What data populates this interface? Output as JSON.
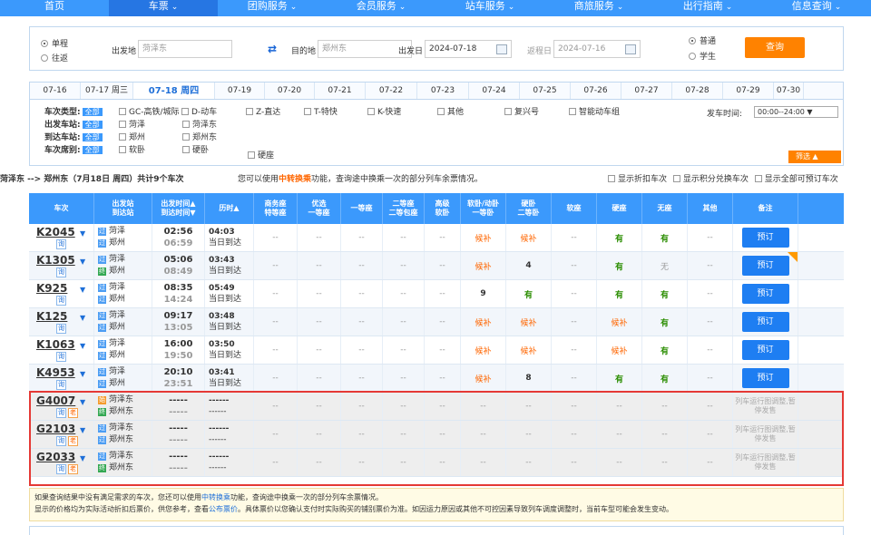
{
  "nav": [
    {
      "label": "首页",
      "chev": ""
    },
    {
      "label": "车票",
      "chev": "⌄"
    },
    {
      "label": "团购服务",
      "chev": "⌄"
    },
    {
      "label": "会员服务",
      "chev": "⌄"
    },
    {
      "label": "站车服务",
      "chev": "⌄"
    },
    {
      "label": "商旅服务",
      "chev": "⌄"
    },
    {
      "label": "出行指南",
      "chev": "⌄"
    },
    {
      "label": "信息查询",
      "chev": "⌄"
    }
  ],
  "search": {
    "oneway": "单程",
    "roundtrip": "往返",
    "from_label": "出发地",
    "from_value": "菏泽东",
    "to_label": "目的地",
    "to_value": "郑州东",
    "depart_label": "出发日",
    "depart_value": "2024-07-18",
    "return_label": "返程日",
    "return_value": "2024-07-16",
    "normal": "普通",
    "student": "学生",
    "query_btn": "查询"
  },
  "dates": [
    "07-16",
    "07-17 周三",
    "07-18 周四",
    "07-19",
    "07-20",
    "07-21",
    "07-22",
    "07-23",
    "07-24",
    "07-25",
    "07-26",
    "07-27",
    "07-28",
    "07-29",
    "07-30"
  ],
  "filters": {
    "type_label": "车次类型:",
    "from_label": "出发车站:",
    "to_label": "到达车站:",
    "seat_label": "车次席别:",
    "all": "全部",
    "types": [
      "GC-高铁/城际",
      "D-动车",
      "Z-直达",
      "T-特快",
      "K-快速",
      "其他",
      "复兴号",
      "智能动车组"
    ],
    "from_stations": [
      "菏泽",
      "菏泽东"
    ],
    "to_stations": [
      "郑州",
      "郑州东"
    ],
    "seats": [
      "软卧",
      "硬卧",
      "硬座"
    ],
    "time_label": "发车时间:",
    "time_value": "00:00--24:00 ▼",
    "filter_btn": "筛选 ▲"
  },
  "summary": {
    "route": "菏泽东 --> 郑州东（7月18日 周四）共计9个车次",
    "hint_pre": "您可以使用",
    "hint_link": "中转换乘",
    "hint_post": "功能，查询途中换乘一次的部分列车余票情况。",
    "opt1": "显示折扣车次",
    "opt2": "显示积分兑换车次",
    "opt3": "显示全部可预订车次"
  },
  "headers": [
    "车次",
    "出发站\n到达站",
    "出发时间▲\n到达时间▼",
    "历时▲",
    "商务座\n特等座",
    "优选\n一等座",
    "一等座",
    "二等座\n二等包座",
    "高级\n软卧",
    "软卧/动卧\n一等卧",
    "硬卧\n二等卧",
    "软座",
    "硬座",
    "无座",
    "其他",
    "备注"
  ],
  "trains": [
    {
      "no": "K2045",
      "tags": [
        "询"
      ],
      "from": "菏泽",
      "from_icon": "过",
      "to": "郑州",
      "to_icon": "过",
      "dep": "02:56",
      "arr": "06:59",
      "dur": "04:03",
      "arrday": "当日到达",
      "seats": [
        "--",
        "--",
        "--",
        "--",
        "--",
        "候补",
        "候补",
        "--",
        "有",
        "有",
        "--"
      ],
      "remark": "预订",
      "corner": false
    },
    {
      "no": "K1305",
      "tags": [
        "询"
      ],
      "from": "菏泽",
      "from_icon": "过",
      "to": "郑州",
      "to_icon": "终",
      "dep": "05:06",
      "arr": "08:49",
      "dur": "03:43",
      "arrday": "当日到达",
      "seats": [
        "--",
        "--",
        "--",
        "--",
        "--",
        "候补",
        "4",
        "--",
        "有",
        "无",
        "--"
      ],
      "remark": "预订",
      "corner": true
    },
    {
      "no": "K925",
      "tags": [
        "询"
      ],
      "from": "菏泽",
      "from_icon": "过",
      "to": "郑州",
      "to_icon": "过",
      "dep": "08:35",
      "arr": "14:24",
      "dur": "05:49",
      "arrday": "当日到达",
      "seats": [
        "--",
        "--",
        "--",
        "--",
        "--",
        "9",
        "有",
        "--",
        "有",
        "有",
        "--"
      ],
      "remark": "预订",
      "corner": false
    },
    {
      "no": "K125",
      "tags": [
        "询"
      ],
      "from": "菏泽",
      "from_icon": "过",
      "to": "郑州",
      "to_icon": "过",
      "dep": "09:17",
      "arr": "13:05",
      "dur": "03:48",
      "arrday": "当日到达",
      "seats": [
        "--",
        "--",
        "--",
        "--",
        "--",
        "候补",
        "候补",
        "--",
        "候补",
        "有",
        "--"
      ],
      "remark": "预订",
      "corner": false
    },
    {
      "no": "K1063",
      "tags": [
        "询"
      ],
      "from": "菏泽",
      "from_icon": "过",
      "to": "郑州",
      "to_icon": "过",
      "dep": "16:00",
      "arr": "19:50",
      "dur": "03:50",
      "arrday": "当日到达",
      "seats": [
        "--",
        "--",
        "--",
        "--",
        "--",
        "候补",
        "候补",
        "--",
        "候补",
        "有",
        "--"
      ],
      "remark": "预订",
      "corner": false
    },
    {
      "no": "K4953",
      "tags": [
        "询"
      ],
      "from": "菏泽",
      "from_icon": "过",
      "to": "郑州",
      "to_icon": "过",
      "dep": "20:10",
      "arr": "23:51",
      "dur": "03:41",
      "arrday": "当日到达",
      "seats": [
        "--",
        "--",
        "--",
        "--",
        "--",
        "候补",
        "8",
        "--",
        "有",
        "有",
        "--"
      ],
      "remark": "预订",
      "corner": false
    },
    {
      "no": "G4007",
      "tags": [
        "询",
        "老"
      ],
      "from": "菏泽东",
      "from_icon": "始",
      "to": "郑州东",
      "to_icon": "终",
      "dep": "-----",
      "arr": "-----",
      "dur": "------",
      "arrday": "------",
      "seats": [
        "--",
        "--",
        "--",
        "--",
        "--",
        "--",
        "--",
        "--",
        "--",
        "--",
        "--"
      ],
      "remark": "列车运行图调整,暂停发售",
      "corner": false
    },
    {
      "no": "G2103",
      "tags": [
        "询",
        "老"
      ],
      "from": "菏泽东",
      "from_icon": "过",
      "to": "郑州东",
      "to_icon": "过",
      "dep": "-----",
      "arr": "-----",
      "dur": "------",
      "arrday": "------",
      "seats": [
        "--",
        "--",
        "--",
        "--",
        "--",
        "--",
        "--",
        "--",
        "--",
        "--",
        "--"
      ],
      "remark": "列车运行图调整,暂停发售",
      "corner": false
    },
    {
      "no": "G2033",
      "tags": [
        "询",
        "老"
      ],
      "from": "菏泽东",
      "from_icon": "过",
      "to": "郑州东",
      "to_icon": "终",
      "dep": "-----",
      "arr": "-----",
      "dur": "------",
      "arrday": "------",
      "seats": [
        "--",
        "--",
        "--",
        "--",
        "--",
        "--",
        "--",
        "--",
        "--",
        "--",
        "--"
      ],
      "remark": "列车运行图调整,暂停发售",
      "corner": false
    }
  ],
  "notes": {
    "line1_pre": "如果查询结果中没有满足需求的车次，您还可以使用",
    "line1_link": "中转换乘",
    "line1_post": "功能，查询途中换乘一次的部分列车余票情况。",
    "line2_pre": "显示的价格均为实际活动折扣后票价，供您参考，查看",
    "line2_link": "公布票价",
    "line2_post": "。具体票价以您确认支付时实际购买的铺别票价为准。如因运力原因或其他不可控因素导致列车调度调整时，当前车型可能会发生变动。"
  }
}
